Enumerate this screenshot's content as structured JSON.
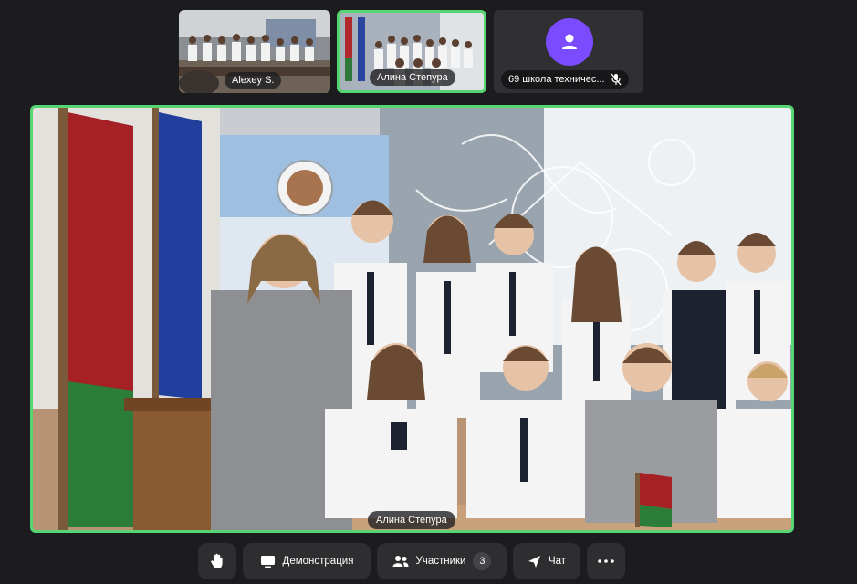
{
  "participants_strip": [
    {
      "name": "Alexey S."
    },
    {
      "name": "Алина Степура"
    },
    {
      "name": "69 школа техничес...",
      "muted_icon": "mic-off-icon"
    }
  ],
  "main_speaker": {
    "name": "Алина Степура"
  },
  "toolbar": {
    "raise_hand_icon": "hand-icon",
    "demonstration_label": "Демонстрация",
    "participants_label": "Участники",
    "participants_count": "3",
    "chat_label": "Чат",
    "more_icon": "more-dots-icon"
  },
  "colors": {
    "background": "#1c1c1e",
    "active_speaker_border": "#55d672",
    "avatar_bg": "#7b4bff",
    "button_bg": "#2e2e31"
  }
}
